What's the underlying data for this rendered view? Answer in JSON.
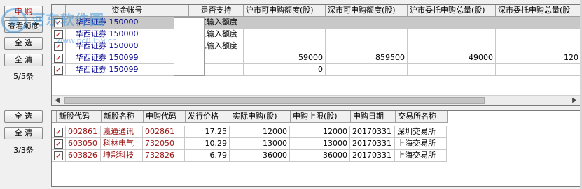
{
  "left_panel": {
    "subscribe_button": "申 购",
    "view_amount_button": "查看额度",
    "select_all_button_1": "全 选",
    "clear_button_1": "全 清",
    "account_count": "5/5条",
    "select_all_button_2": "全 选",
    "clear_button_2": "全 清",
    "stock_count": "3/3条"
  },
  "watermark": {
    "text": "河东软件园",
    "url": "www.pc0359.cn"
  },
  "accounts_table": {
    "columns": [
      "",
      "资金帐号",
      "是否支持",
      "沪市可申购额度(股)",
      "深市可申购额度(股)",
      "沪市委托申购总量(股)",
      "深市委托申购总量(股"
    ],
    "rows": [
      {
        "checked": "✓",
        "account": "华西证券 150000",
        "support": "手工输入额度",
        "sh_quota": "",
        "sz_quota": "",
        "sh_total": "",
        "sz_total": ""
      },
      {
        "checked": "✓",
        "account": "华西证券 150000",
        "support": "手工输入额度",
        "sh_quota": "",
        "sz_quota": "",
        "sh_total": "",
        "sz_total": ""
      },
      {
        "checked": "✓",
        "account": "华西证券 150000",
        "support": "手工输入额度",
        "sh_quota": "",
        "sz_quota": "",
        "sh_total": "",
        "sz_total": ""
      },
      {
        "checked": "✓",
        "account": "华西证券 150099",
        "support": "",
        "sh_quota": "59000",
        "sz_quota": "859500",
        "sh_total": "49000",
        "sz_total": "120"
      },
      {
        "checked": "✓",
        "account": "华西证券 150099",
        "support": "",
        "sh_quota": "0",
        "sz_quota": "",
        "sh_total": "",
        "sz_total": ""
      }
    ]
  },
  "stocks_table": {
    "columns": [
      "",
      "新股代码",
      "新股名称",
      "申购代码",
      "发行价格",
      "实际申购(股)",
      "申购上限(股)",
      "申购日期",
      "交易所名称"
    ],
    "rows": [
      {
        "checked": "✓",
        "code": "002861",
        "name": "瀛通通讯",
        "sub_code": "002861",
        "price": "17.25",
        "actual": "12000",
        "limit": "12000",
        "date": "20170331",
        "exchange": "深圳交易所"
      },
      {
        "checked": "✓",
        "code": "603050",
        "name": "科林电气",
        "sub_code": "732050",
        "price": "10.29",
        "actual": "13000",
        "limit": "13000",
        "date": "20170331",
        "exchange": "上海交易所"
      },
      {
        "checked": "✓",
        "code": "603826",
        "name": "坤彩科技",
        "sub_code": "732826",
        "price": "6.79",
        "actual": "36000",
        "limit": "36000",
        "date": "20170331",
        "exchange": "上海交易所"
      }
    ]
  }
}
